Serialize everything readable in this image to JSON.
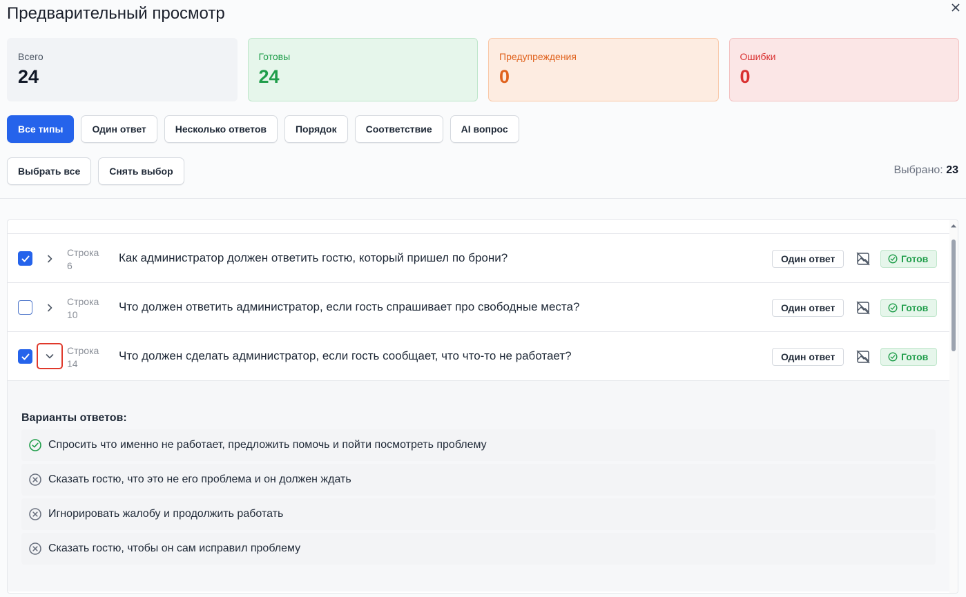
{
  "dialog": {
    "title": "Предварительный просмотр"
  },
  "stats": {
    "total": {
      "label": "Всего",
      "value": "24"
    },
    "ready": {
      "label": "Готовы",
      "value": "24"
    },
    "warnings": {
      "label": "Предупреждения",
      "value": "0"
    },
    "errors": {
      "label": "Ошибки",
      "value": "0"
    }
  },
  "filters": [
    "Все типы",
    "Один ответ",
    "Несколько ответов",
    "Порядок",
    "Соответствие",
    "AI вопрос"
  ],
  "selection": {
    "select_all": "Выбрать все",
    "clear": "Снять выбор",
    "selected_label": "Выбрано:",
    "selected_count": "23"
  },
  "rows": [
    {
      "label": "Строка",
      "number": "6",
      "question": "Как администратор должен ответить гостю, который пришел по брони?",
      "type": "Один ответ",
      "status": "Готов",
      "checked": true
    },
    {
      "label": "Строка",
      "number": "10",
      "question": "Что должен ответить администратор, если гость спрашивает про свободные места?",
      "type": "Один ответ",
      "status": "Готов",
      "checked": false
    },
    {
      "label": "Строка",
      "number": "14",
      "question": "Что должен сделать администратор, если гость сообщает, что что-то не работает?",
      "type": "Один ответ",
      "status": "Готов",
      "checked": true
    }
  ],
  "expanded": {
    "title": "Варианты ответов:",
    "answers": [
      {
        "text": "Спросить что именно не работает, предложить помочь и пойти посмотреть проблему",
        "correct": true
      },
      {
        "text": "Сказать гостю, что это не его проблема и он должен ждать",
        "correct": false
      },
      {
        "text": "Игнорировать жалобу и продолжить работать",
        "correct": false
      },
      {
        "text": "Сказать гостю, чтобы он сам исправил проблему",
        "correct": false
      }
    ]
  },
  "colors": {
    "primary": "#2563eb",
    "success": "#1f9d4a",
    "warning": "#e0621d",
    "error": "#d93030"
  }
}
